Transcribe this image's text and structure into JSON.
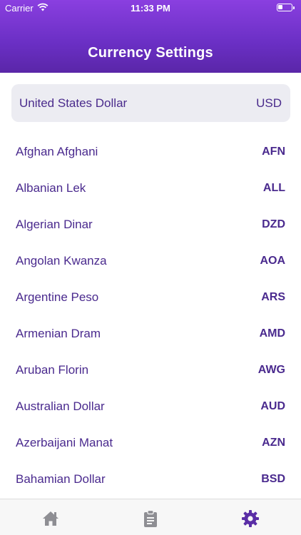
{
  "status_bar": {
    "carrier": "Carrier",
    "time": "11:33 PM",
    "wifi_icon": "wifi-icon",
    "battery_icon": "battery-icon"
  },
  "header": {
    "title": "Currency Settings",
    "gradient_colors": [
      "#8a3fe0",
      "#5a26a8"
    ]
  },
  "selected_currency": {
    "name": "United States Dollar",
    "code": "USD"
  },
  "currencies": [
    {
      "name": "Afghan Afghani",
      "code": "AFN"
    },
    {
      "name": "Albanian Lek",
      "code": "ALL"
    },
    {
      "name": "Algerian Dinar",
      "code": "DZD"
    },
    {
      "name": "Angolan Kwanza",
      "code": "AOA"
    },
    {
      "name": "Argentine Peso",
      "code": "ARS"
    },
    {
      "name": "Armenian Dram",
      "code": "AMD"
    },
    {
      "name": "Aruban Florin",
      "code": "AWG"
    },
    {
      "name": "Australian Dollar",
      "code": "AUD"
    },
    {
      "name": "Azerbaijani Manat",
      "code": "AZN"
    },
    {
      "name": "Bahamian Dollar",
      "code": "BSD"
    }
  ],
  "tab_bar": {
    "tabs": [
      {
        "icon": "home-icon",
        "active": false
      },
      {
        "icon": "clipboard-icon",
        "active": false
      },
      {
        "icon": "gear-icon",
        "active": true
      }
    ],
    "active_color": "#5a2ea6",
    "inactive_color": "#8e8e93"
  }
}
